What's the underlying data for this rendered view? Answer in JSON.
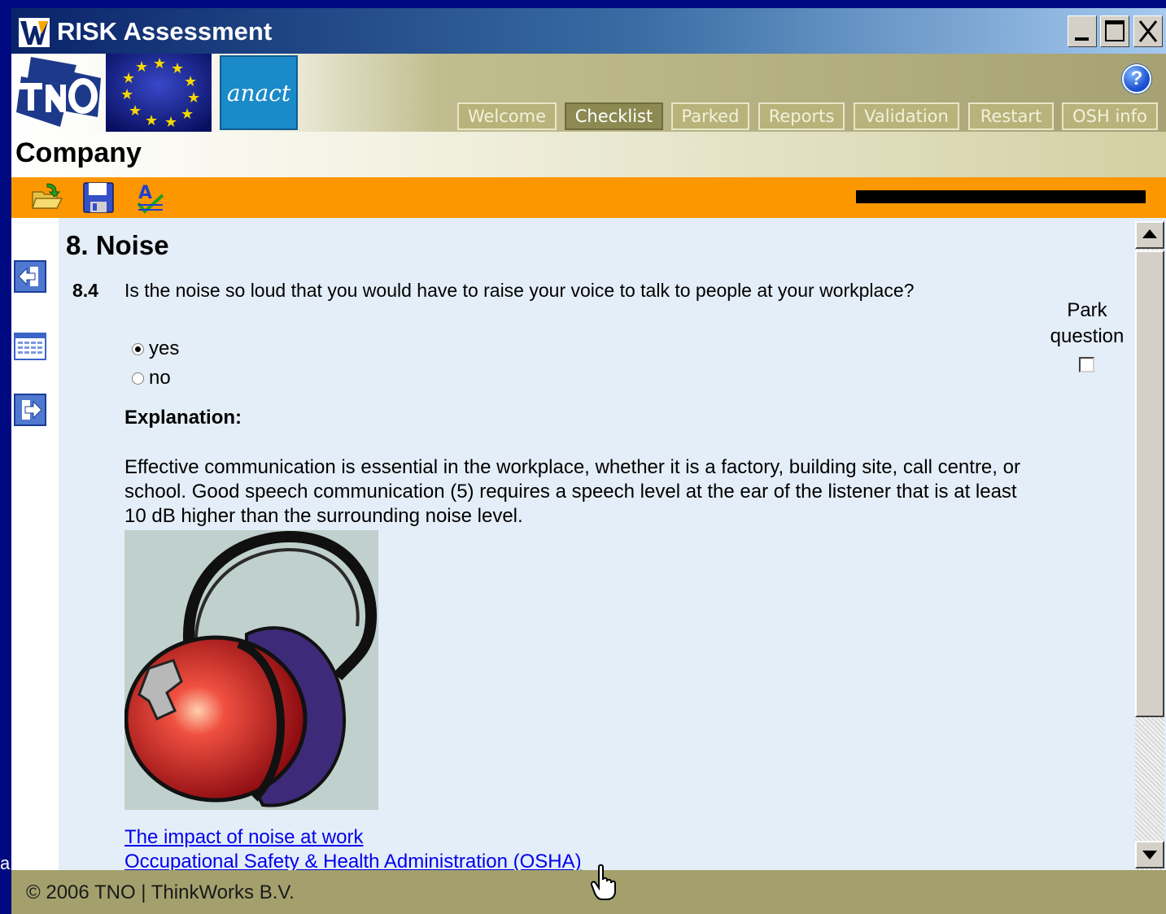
{
  "window": {
    "title": "RISK Assessment",
    "minimize_label": "_",
    "maximize_label": "□",
    "close_label": "X"
  },
  "header": {
    "anact_logo_text": "anact",
    "help_icon_label": "?",
    "tabs": [
      {
        "label": "Welcome",
        "active": false
      },
      {
        "label": "Checklist",
        "active": true
      },
      {
        "label": "Parked",
        "active": false
      },
      {
        "label": "Reports",
        "active": false
      },
      {
        "label": "Validation",
        "active": false
      },
      {
        "label": "Restart",
        "active": false
      },
      {
        "label": "OSH info",
        "active": false
      }
    ]
  },
  "company": {
    "title": "Company"
  },
  "toolbar": {
    "icons": [
      "open-folder-icon",
      "save-icon",
      "spellcheck-icon"
    ]
  },
  "left_rail": {
    "icons": [
      "previous-icon",
      "overview-icon",
      "next-icon"
    ]
  },
  "section": {
    "title": "8. Noise"
  },
  "question": {
    "number": "8.4",
    "text": "Is the noise so loud that you would have to raise your voice to talk to people at your workplace?",
    "options": [
      {
        "label": "yes",
        "selected": true
      },
      {
        "label": "no",
        "selected": false
      }
    ],
    "park_label": "Park question",
    "park_checked": false
  },
  "explanation": {
    "heading": "Explanation:",
    "text": "Effective communication is essential in the workplace, whether it is a factory, building site, call centre, or school. Good speech communication (5) requires a speech level at the ear of the listener that is at least 10 dB higher than the surrounding noise level."
  },
  "links": [
    "The impact of noise at work",
    "Occupational Safety & Health Administration (OSHA)"
  ],
  "footer": {
    "text": "© 2006 TNO | ThinkWorks B.V."
  },
  "stray_char": "a",
  "colors": {
    "desktop": "#000a80",
    "toolbar": "#fc9700",
    "content": "#e4eef8",
    "footer": "#a3a06d",
    "link": "#0000ee"
  }
}
